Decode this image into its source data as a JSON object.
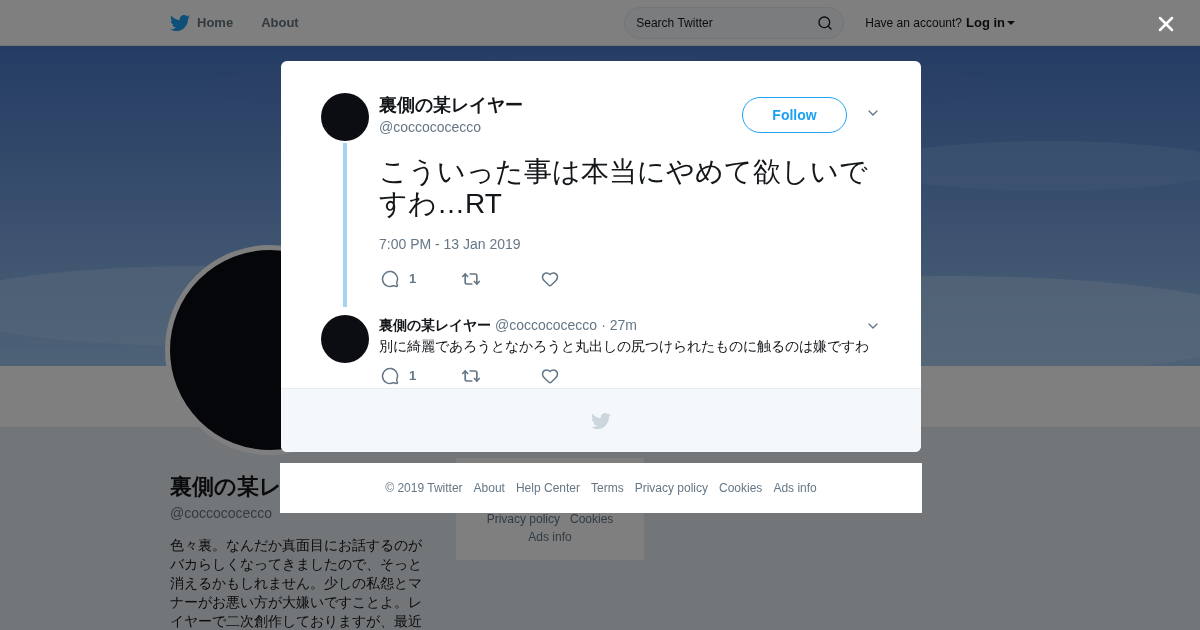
{
  "header": {
    "nav": [
      "Home",
      "About"
    ],
    "search": {
      "placeholder": "Search Twitter"
    },
    "account_prompt": "Have an account?",
    "login": "Log in"
  },
  "profile": {
    "name": "裏側の某レ",
    "handle": "@coccococecco",
    "bio": "色々裏。なんだか真面目にお話するのがバカらしくなってきましたので、そっと消えるかもしれません。少しの私怨とマナーがお悪い方が大嫌いですことよ。レイヤーで二次創作しておりますが、最近"
  },
  "sidebar_footer": {
    "links": [
      "Privacy policy",
      "Cookies",
      "Ads info"
    ]
  },
  "modal": {
    "tweet": {
      "name": "裏側の某レイヤー",
      "handle": "@coccococecco",
      "follow": "Follow",
      "text": "こういった事は本当にやめて欲しいですわ…RT",
      "date": "7:00 PM - 13 Jan 2019",
      "replies": "1"
    },
    "reply": {
      "name": "裏側の某レイヤー",
      "handle": "@coccococecco",
      "time": "· 27m",
      "text": "別に綺麗であろうとなかろうと丸出しの尻つけられたものに触るのは嫌ですわ",
      "replies": "1"
    }
  },
  "footer": {
    "links": [
      "© 2019 Twitter",
      "About",
      "Help Center",
      "Terms",
      "Privacy policy",
      "Cookies",
      "Ads info"
    ]
  }
}
